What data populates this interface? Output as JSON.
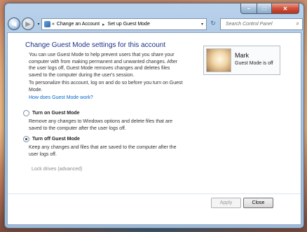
{
  "window": {
    "caption": {
      "minimize": "–",
      "maximize": "□",
      "close": "✕"
    }
  },
  "nav": {
    "back_glyph": "◀",
    "forward_glyph": "▶",
    "history_glyph": "▾",
    "address": {
      "prefix": "«",
      "crumbs": [
        "Change an Account",
        "Set up Guest Mode"
      ],
      "sep": "▸",
      "dropdown": "▾"
    },
    "refresh_glyph": "↻",
    "search": {
      "placeholder": "Search Control Panel",
      "icon_glyph": "⌕"
    }
  },
  "main": {
    "title": "Change Guest Mode settings for this account",
    "intro": "You can use Guest Mode to help prevent users that you share your computer with from making permanent and unwanted changes. After the user logs off, Guest Mode removes changes and deletes files saved to the computer during the user's session.",
    "personalize": "To personalize this account, log on and do so before you turn on Guest Mode.",
    "help_link": "How does Guest Mode work?",
    "options": [
      {
        "label": "Turn on Guest Mode",
        "description": "Remove any changes to Windows options and delete files that are saved to the computer after the user logs off.",
        "selected": false
      },
      {
        "label": "Turn off Guest Mode",
        "description": "Keep any changes and  files that are saved to the computer after the user logs off.",
        "selected": true
      }
    ],
    "lock_drives": "Lock drives (advanced)"
  },
  "user": {
    "name": "Mark",
    "status": "Guest Mode is off"
  },
  "buttons": {
    "apply": "Apply",
    "close": "Close"
  }
}
